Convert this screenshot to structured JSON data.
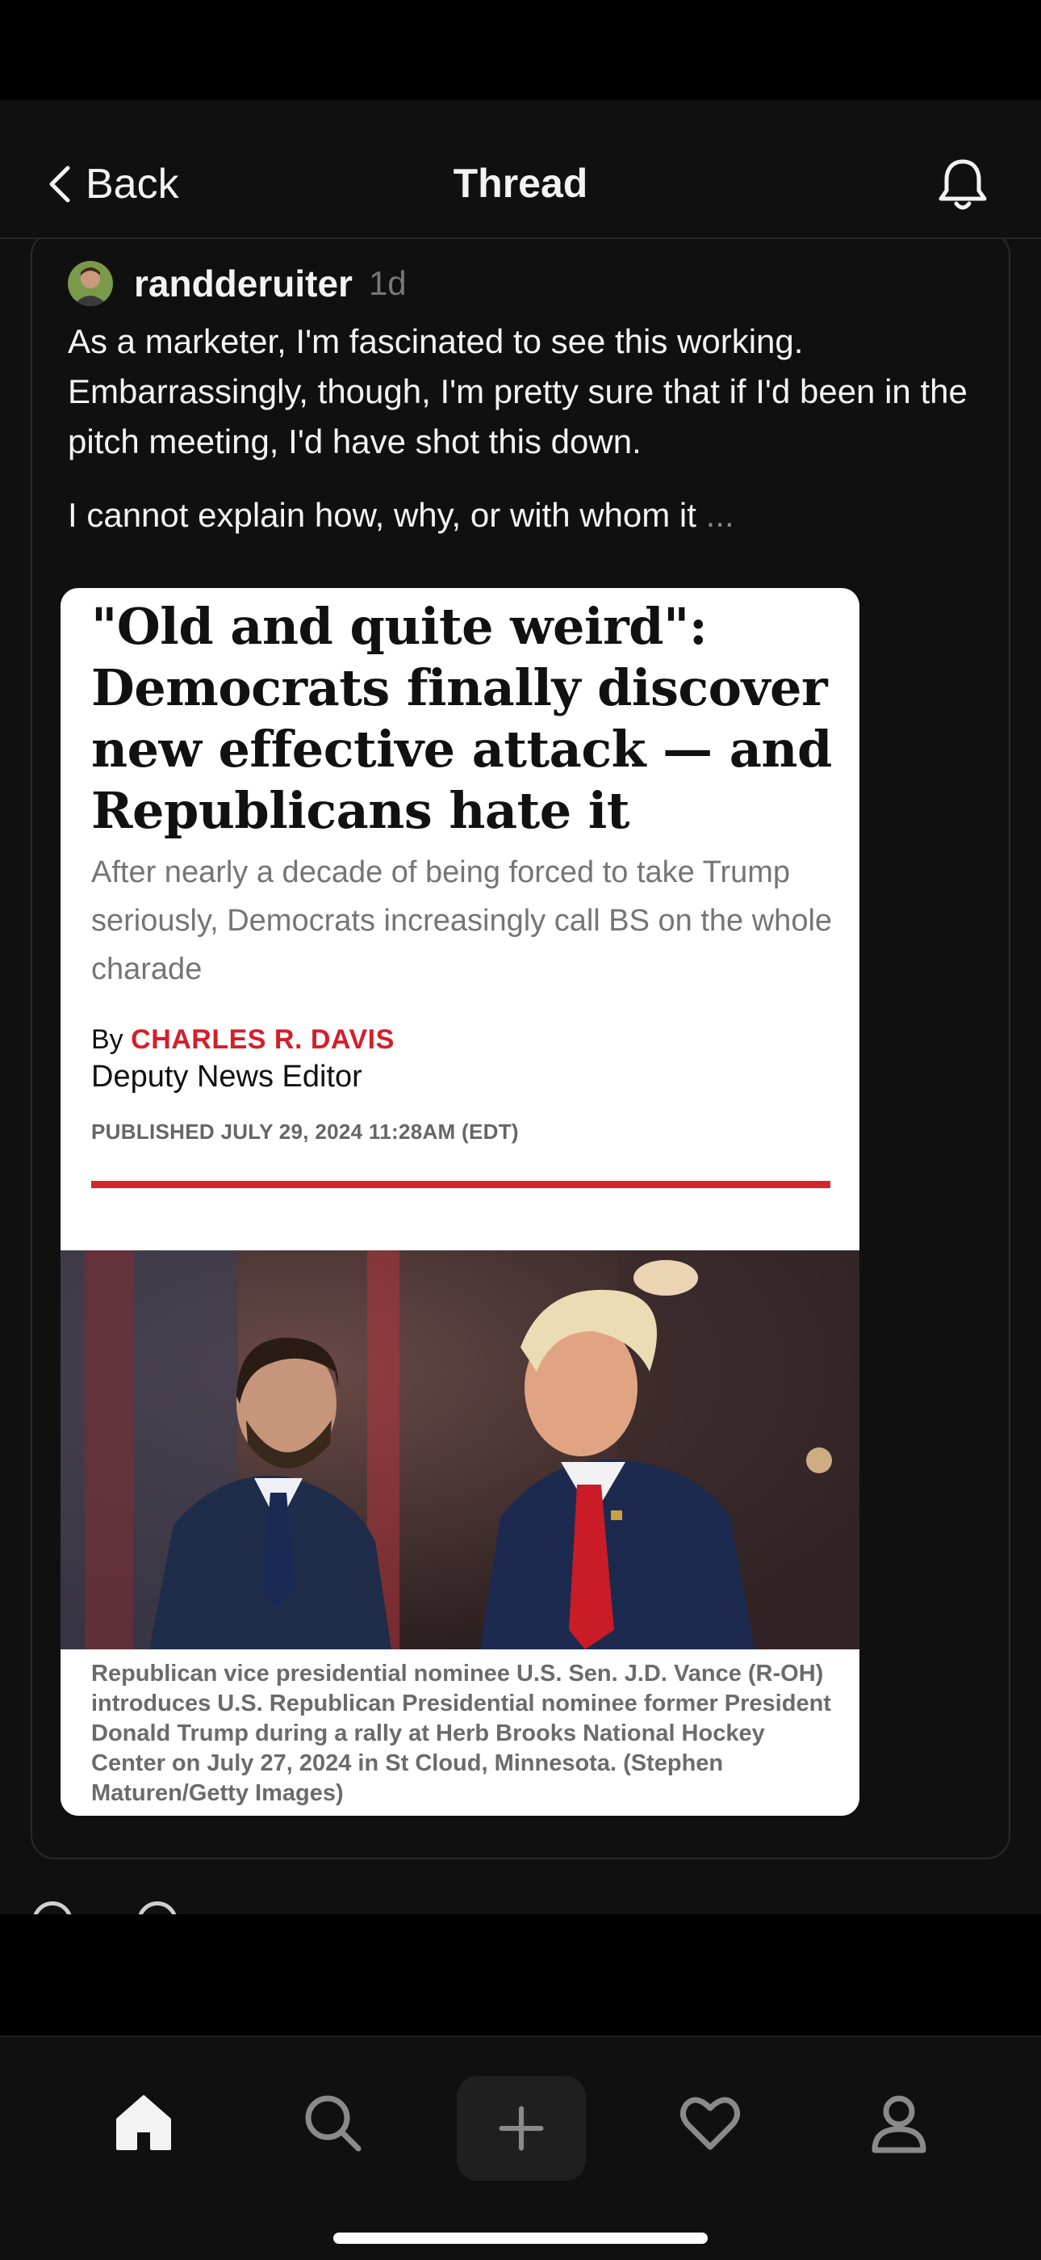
{
  "header": {
    "back_label": "Back",
    "title": "Thread",
    "bell_icon": "bell-icon"
  },
  "post": {
    "username": "randderuiter",
    "time": "1d",
    "text": "As a marketer, I'm fascinated to see this working. Embarrassingly, though, I'm pretty sure that if I'd been in the pitch meeting, I'd have shot this down.",
    "text_more": "I cannot explain how, why, or with whom it",
    "ellipsis": "..."
  },
  "article": {
    "headline": "\"Old and quite weird\": Democrats finally discover new effective attack — and Republicans hate it",
    "dek": "After nearly a decade of being forced to take Trump seriously, Democrats increasingly call BS on the whole charade",
    "by_prefix": "By",
    "author": "CHARLES R. DAVIS",
    "role": "Deputy News Editor",
    "published": "PUBLISHED JULY 29, 2024 11:28AM (EDT)",
    "caption": "Republican vice presidential nominee U.S. Sen. J.D. Vance (R-OH) introduces U.S. Republican Presidential nominee former President Donald Trump during a rally at Herb Brooks National Hockey Center on July 27, 2024 in St Cloud, Minnesota. (Stephen Maturen/Getty Images)",
    "accent_color": "#d6232f"
  },
  "tabbar": {
    "tabs": [
      "home-icon",
      "search-icon",
      "plus-icon",
      "heart-icon",
      "person-icon"
    ]
  },
  "theme": {
    "background": "#101010",
    "text": "#f3f3f3",
    "muted": "#777777"
  }
}
